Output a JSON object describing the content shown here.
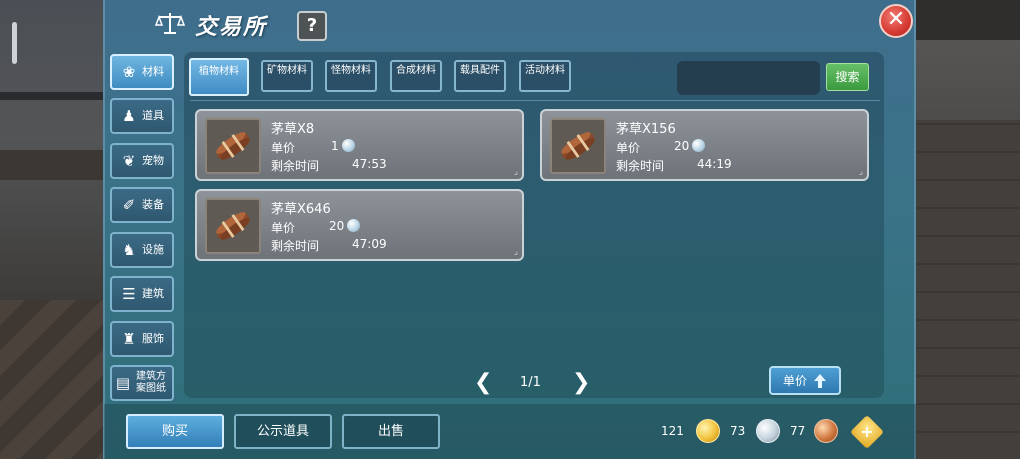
{
  "header": {
    "title": "交易所",
    "help_label": "?",
    "close_label": "✕"
  },
  "sidebar": {
    "items": [
      {
        "label": "材料",
        "icon": "materials-icon",
        "glyph": "❀",
        "active": true
      },
      {
        "label": "道具",
        "icon": "potion-icon",
        "glyph": "♟",
        "active": false
      },
      {
        "label": "宠物",
        "icon": "paw-icon",
        "glyph": "❦",
        "active": false
      },
      {
        "label": "装备",
        "icon": "equipment-icon",
        "glyph": "✐",
        "active": false
      },
      {
        "label": "设施",
        "icon": "facility-icon",
        "glyph": "♞",
        "active": false
      },
      {
        "label": "建筑",
        "icon": "building-icon",
        "glyph": "☰",
        "active": false
      },
      {
        "label": "服饰",
        "icon": "clothing-icon",
        "glyph": "♜",
        "active": false
      },
      {
        "label": "建筑方案图纸",
        "icon": "blueprint-icon",
        "glyph": "▤",
        "active": false
      }
    ]
  },
  "categories": [
    {
      "label": "植物材料",
      "active": true
    },
    {
      "label": "矿物材料",
      "active": false
    },
    {
      "label": "怪物材料",
      "active": false
    },
    {
      "label": "合成材料",
      "active": false
    },
    {
      "label": "载具配件",
      "active": false
    },
    {
      "label": "活动材料",
      "active": false
    }
  ],
  "search": {
    "value": "",
    "placeholder": "",
    "button_label": "搜索"
  },
  "listings": [
    {
      "name": "茅草X8",
      "price_label": "单价",
      "price": "1",
      "time_label": "剩余时间",
      "time": "47:53",
      "item_icon": "thatch-bundle-icon"
    },
    {
      "name": "茅草X156",
      "price_label": "单价",
      "price": "20",
      "time_label": "剩余时间",
      "time": "44:19",
      "item_icon": "thatch-bundle-icon"
    },
    {
      "name": "茅草X646",
      "price_label": "单价",
      "price": "20",
      "time_label": "剩余时间",
      "time": "47:09",
      "item_icon": "thatch-bundle-icon"
    }
  ],
  "pagination": {
    "prev": "❮",
    "text": "1/1",
    "next": "❯"
  },
  "sort": {
    "label": "单价",
    "direction_icon": "arrow-up-icon"
  },
  "actions": [
    {
      "label": "购买",
      "active": true
    },
    {
      "label": "公示道具",
      "active": false
    },
    {
      "label": "出售",
      "active": false
    }
  ],
  "wallet": {
    "gold": "121",
    "silver": "73",
    "copper": "77"
  },
  "colors": {
    "panel": "#3a7388",
    "accent_blue": "#3f8bc4",
    "search_green": "#3b9a3f",
    "close_red": "#d63a33"
  }
}
